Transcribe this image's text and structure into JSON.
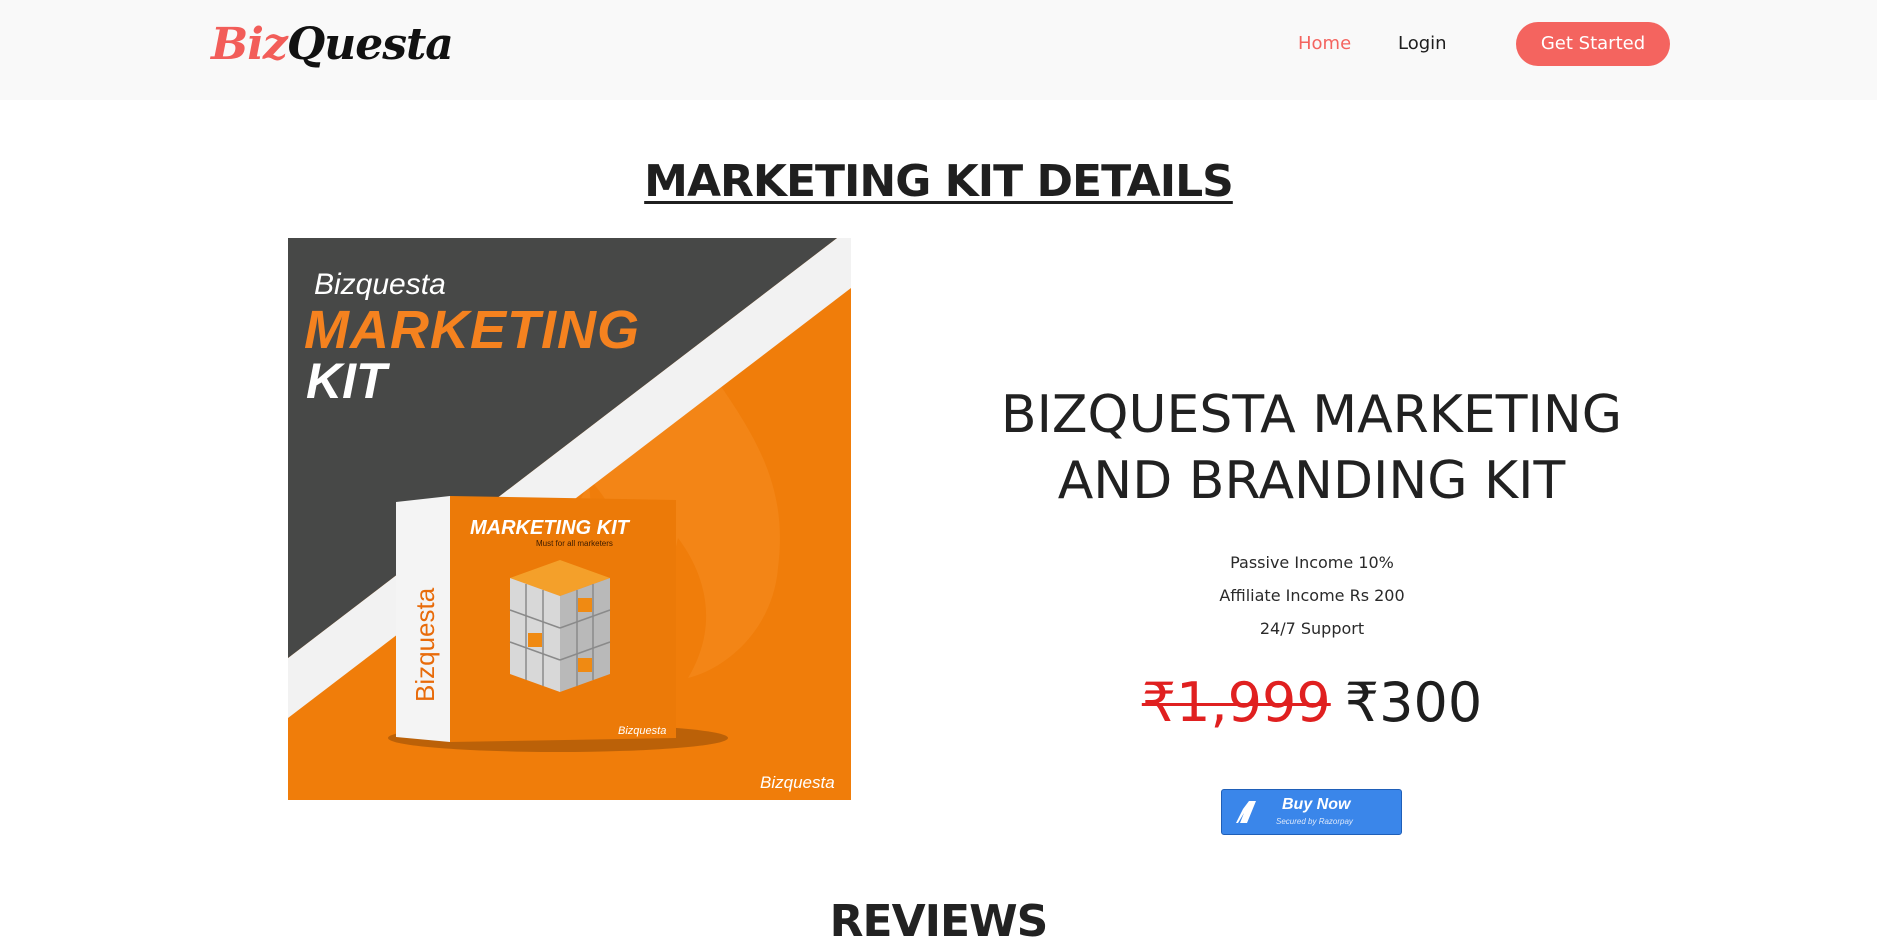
{
  "header": {
    "logo_part1": "Biz",
    "logo_part2": "Questa",
    "nav": {
      "home": "Home",
      "login": "Login"
    },
    "cta": "Get Started"
  },
  "section_title": "MARKETING KIT DETAILS",
  "product_image": {
    "brand": "Bizquesta",
    "headline_line1": "MARKETING",
    "headline_line2": "KIT",
    "box_title": "MARKETING KIT",
    "box_subtitle": "Must for all marketers",
    "box_side_brand": "Bizquesta",
    "box_corner_brand": "Bizquesta",
    "corner_brand": "Bizquesta"
  },
  "product": {
    "name": "BIZQUESTA MARKETING AND BRANDING KIT",
    "features": [
      "Passive Income 10%",
      "Affiliate Income Rs 200",
      "24/7 Support"
    ],
    "old_price": "₹1,999",
    "new_price": "₹300"
  },
  "buy_button": {
    "label": "Buy Now",
    "sublabel": "Secured by Razorpay"
  },
  "reviews_title": "REVIEWS",
  "colors": {
    "accent": "#f4645f",
    "orange": "#f07d0a",
    "dark_panel": "#474847",
    "strike_red": "#e02020",
    "razorpay_blue": "#3a86ea"
  }
}
